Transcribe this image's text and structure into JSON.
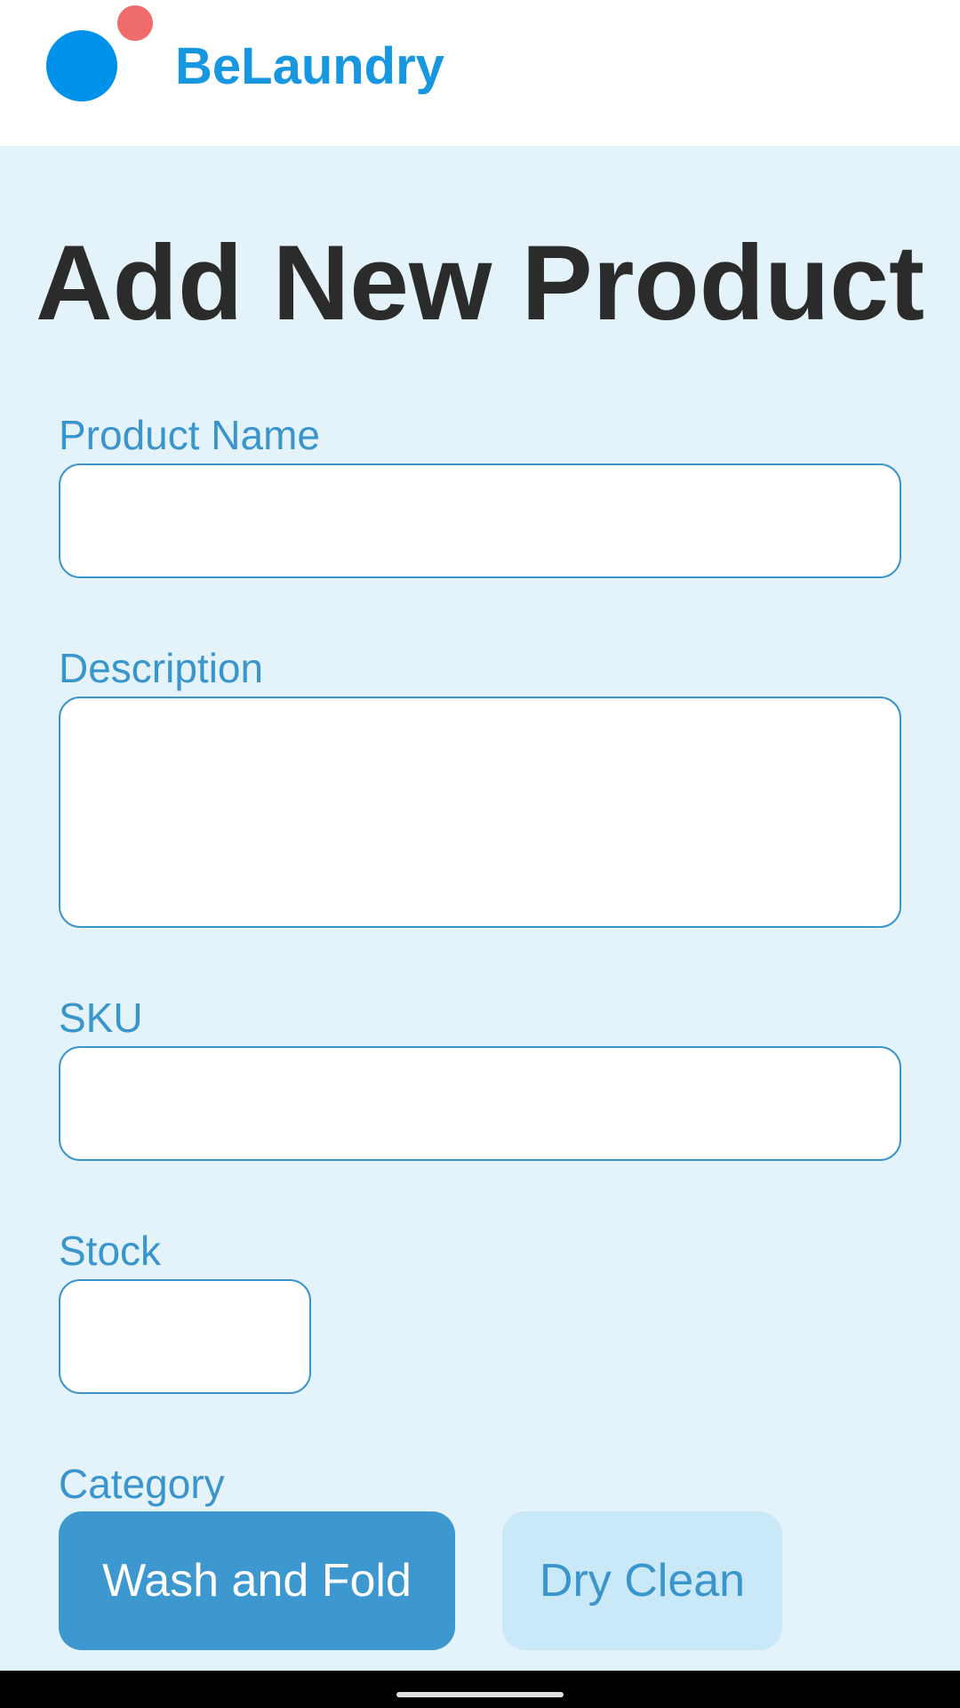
{
  "app": {
    "name": "BeLaundry",
    "colors": {
      "brand_blue": "#0091ea",
      "brand_red": "#f06b6b",
      "accent": "#3a95cc",
      "background": "#e4f3fa"
    }
  },
  "page": {
    "title": "Add New Product"
  },
  "form": {
    "product_name": {
      "label": "Product Name",
      "value": ""
    },
    "description": {
      "label": "Description",
      "value": ""
    },
    "sku": {
      "label": "SKU",
      "value": ""
    },
    "stock": {
      "label": "Stock",
      "value": ""
    },
    "category": {
      "label": "Category",
      "options": [
        {
          "label": "Wash and Fold",
          "selected": true
        },
        {
          "label": "Dry Clean",
          "selected": false
        }
      ]
    }
  },
  "system": {
    "nav_icon": "home-handle-icon"
  }
}
